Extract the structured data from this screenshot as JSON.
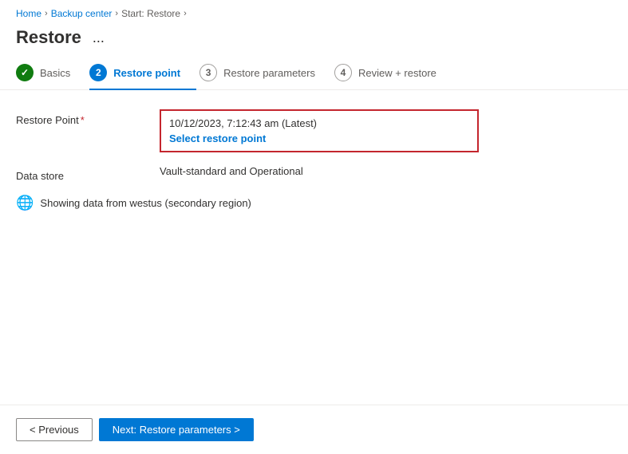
{
  "breadcrumb": {
    "home": "Home",
    "backup_center": "Backup center",
    "start_restore": "Start: Restore"
  },
  "page": {
    "title": "Restore",
    "ellipsis": "..."
  },
  "tabs": [
    {
      "id": "basics",
      "label": "Basics",
      "number": "✓",
      "state": "completed"
    },
    {
      "id": "restore-point",
      "label": "Restore point",
      "number": "2",
      "state": "active"
    },
    {
      "id": "restore-parameters",
      "label": "Restore parameters",
      "number": "3",
      "state": "inactive"
    },
    {
      "id": "review-restore",
      "label": "Review + restore",
      "number": "4",
      "state": "inactive"
    }
  ],
  "form": {
    "restore_point_label": "Restore Point",
    "restore_point_value": "10/12/2023, 7:12:43 am (Latest)",
    "select_restore_point_link": "Select restore point",
    "data_store_label": "Data store",
    "data_store_value": "Vault-standard and Operational",
    "info_text": "Showing data from westus (secondary region)"
  },
  "footer": {
    "previous_label": "< Previous",
    "next_label": "Next: Restore parameters >"
  }
}
